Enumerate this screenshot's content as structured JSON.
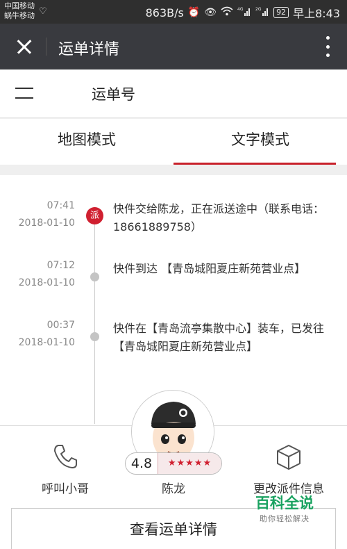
{
  "status_bar": {
    "carrier1": "中国移动",
    "carrier2": "蜗牛移动",
    "speed": "863B/s",
    "battery": "92",
    "time": "早上8:43",
    "network1": "4G",
    "network2": "2G"
  },
  "header": {
    "title": "运单详情"
  },
  "waybill": {
    "label": "运单号"
  },
  "tabs": [
    {
      "label": "地图模式",
      "active": false
    },
    {
      "label": "文字模式",
      "active": true
    }
  ],
  "timeline": [
    {
      "time": "07:41",
      "date": "2018-01-10",
      "badge": "派",
      "text": "快件交给陈龙，正在派送途中（联系电话：18661889758）"
    },
    {
      "time": "07:12",
      "date": "2018-01-10",
      "text": "快件到达 【青岛城阳夏庄新苑营业点】"
    },
    {
      "time": "00:37",
      "date": "2018-01-10",
      "text": "快件在【青岛流亭集散中心】装车，已发往 【青岛城阳夏庄新苑营业点】"
    }
  ],
  "courier": {
    "name": "陈龙",
    "rating": "4.8",
    "stars": 5,
    "call_label": "呼叫小哥",
    "change_label": "更改派件信息",
    "view_details_label": "查看运单详情"
  },
  "watermark": {
    "title": "百科全说",
    "subtitle": "助你轻松解决"
  },
  "colors": {
    "accent": "#c8202a",
    "header_bg": "#393a3f",
    "status_bg": "#2f2f2f"
  }
}
